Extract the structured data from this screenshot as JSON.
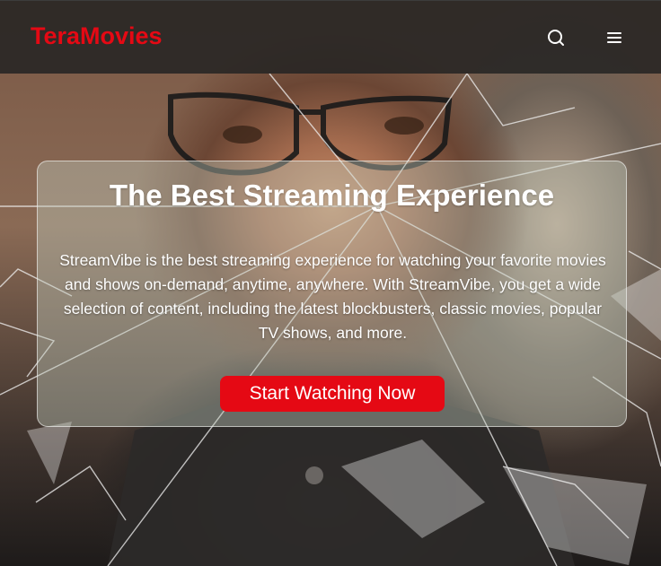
{
  "header": {
    "logo_text": "TeraMovies",
    "search_icon": "search-icon",
    "menu_icon": "hamburger-menu-icon"
  },
  "hero": {
    "title": "The Best Streaming Experience",
    "description": "StreamVibe is the best streaming experience for watching your favorite movies and shows on-demand, anytime, anywhere. With StreamVibe, you get a wide selection of content, including the latest blockbusters, classic movies, popular TV shows, and more.",
    "cta_label": "Start Watching Now"
  },
  "colors": {
    "brand": "#e50914",
    "header_bg": "#262423",
    "text": "#ffffff"
  }
}
